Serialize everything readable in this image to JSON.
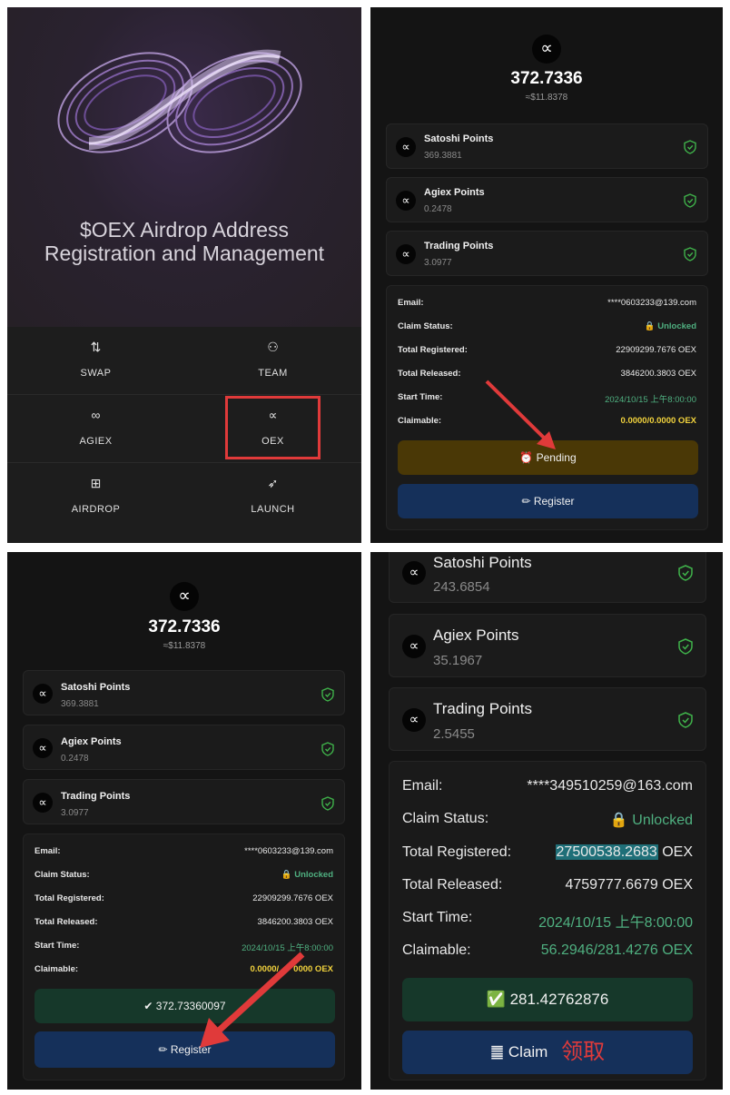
{
  "colors": {
    "panel_bg": "#141414",
    "card_bg": "#1b1b1b",
    "verified_green": "#3fb24a",
    "unlocked_green": "#4fb080",
    "claimable_yellow": "#f2d33d",
    "pending_bg": "#4a3806",
    "register_bg": "#15305a",
    "success_bg": "#16382a",
    "annotation_red": "#e03a3a"
  },
  "menu": {
    "hero_title_line1": "$OEX Airdrop Address",
    "hero_title_line2": "Registration and Management",
    "items": [
      {
        "label": "SWAP",
        "icon": "swap-arrows-icon",
        "glyph": "⇅"
      },
      {
        "label": "TEAM",
        "icon": "team-icon",
        "glyph": "⚇"
      },
      {
        "label": "AGIEX",
        "icon": "infinity-icon",
        "glyph": "∞"
      },
      {
        "label": "OEX",
        "icon": "oex-logo-icon",
        "glyph": "∝"
      },
      {
        "label": "AIRDROP",
        "icon": "gift-icon",
        "glyph": "⊞"
      },
      {
        "label": "LAUNCH",
        "icon": "rocket-icon",
        "glyph": "➶"
      }
    ]
  },
  "wallet_a": {
    "logo_glyph": "∝",
    "balance": "372.7336",
    "balance_usd": "≈$11.8378",
    "points": [
      {
        "title": "Satoshi Points",
        "value": "369.3881"
      },
      {
        "title": "Agiex Points",
        "value": "0.2478"
      },
      {
        "title": "Trading Points",
        "value": "3.0977"
      }
    ],
    "rows": [
      {
        "key": "Email:",
        "value": "****0603233@139.com"
      },
      {
        "key": "Claim Status:",
        "value": "🔒 Unlocked"
      },
      {
        "key": "Total Registered:",
        "value": "22909299.7676 OEX"
      },
      {
        "key": "Total Released:",
        "value": "3846200.3803 OEX"
      },
      {
        "key": "Start Time:",
        "value": "2024/10/15 上午8:00:00"
      },
      {
        "key": "Claimable:",
        "value": "0.0000/0.0000 OEX"
      }
    ],
    "pending_button": "⏰ Pending",
    "register_button": "✏ Register",
    "success_button": "✔ 372.73360097",
    "claimable_partial": "0.0000/",
    "claimable_partial_tail": "0000 OEX"
  },
  "wallet_b": {
    "points": [
      {
        "title": "Satoshi Points",
        "value": "243.6854"
      },
      {
        "title": "Agiex Points",
        "value": "35.1967"
      },
      {
        "title": "Trading Points",
        "value": "2.5455"
      }
    ],
    "rows": [
      {
        "key": "Email:",
        "value": "****349510259@163.com"
      },
      {
        "key": "Claim Status:",
        "value": "🔒 Unlocked"
      },
      {
        "key": "Total Registered:",
        "value": "27500538.2683",
        "unit": " OEX"
      },
      {
        "key": "Total Released:",
        "value": "4759777.6679 OEX"
      },
      {
        "key": "Start Time:",
        "value": "2024/10/15 上午8:00:00"
      },
      {
        "key": "Claimable:",
        "value": "56.2946/281.4276 OEX"
      }
    ],
    "success_button": "✅ 281.42762876",
    "claim_button": "䷀ Claim",
    "claim_chinese": "领取"
  }
}
